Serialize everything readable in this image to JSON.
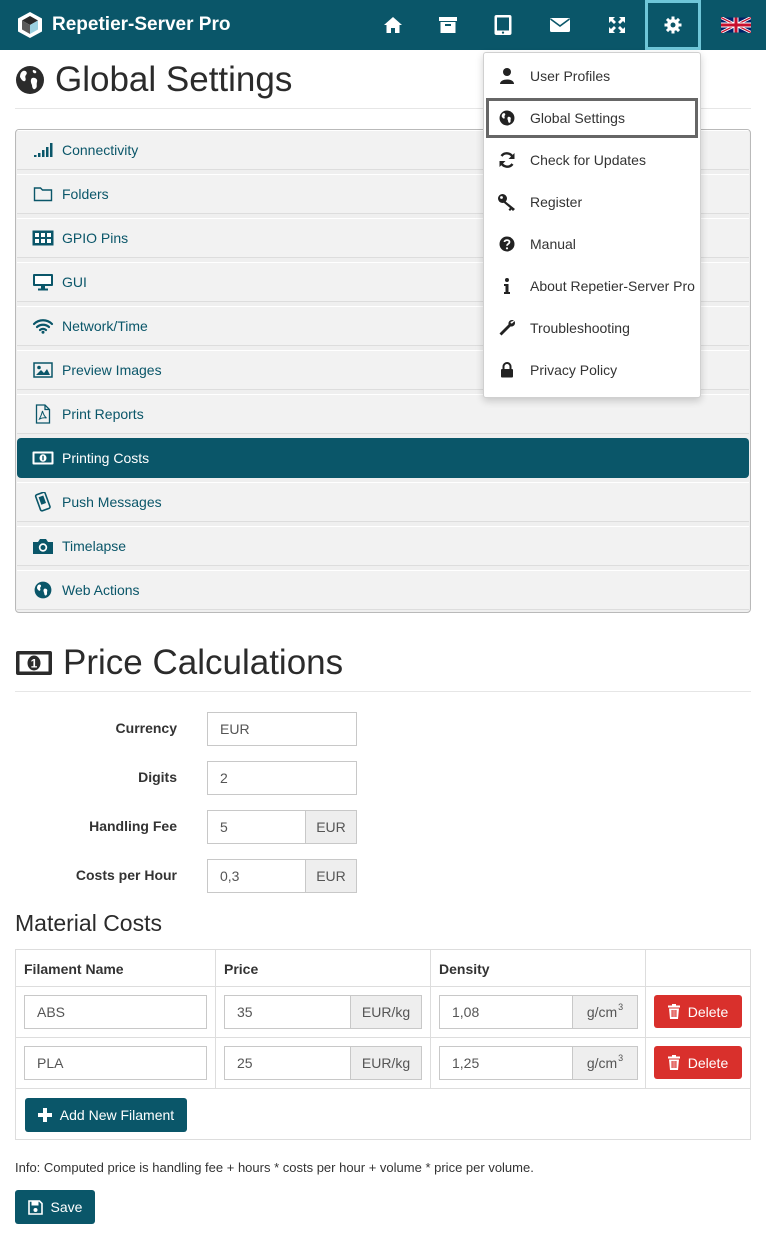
{
  "app": {
    "title": "Repetier-Server Pro"
  },
  "navbar": {
    "buttons": [
      "home-icon",
      "archive-icon",
      "tablet-icon",
      "envelope-icon",
      "fullscreen-icon",
      "gear-icon",
      "uk-flag-icon"
    ],
    "accent": "#0a5669"
  },
  "dropdown": {
    "items": [
      {
        "label": "User Profiles",
        "icon": "user-icon"
      },
      {
        "label": "Global Settings",
        "icon": "globe-icon",
        "selected": true
      },
      {
        "label": "Check for Updates",
        "icon": "refresh-icon"
      },
      {
        "label": "Register",
        "icon": "key-icon"
      },
      {
        "label": "Manual",
        "icon": "question-icon"
      },
      {
        "label": "About Repetier-Server Pro",
        "icon": "info-icon"
      },
      {
        "label": "Troubleshooting",
        "icon": "wrench-icon"
      },
      {
        "label": "Privacy Policy",
        "icon": "lock-icon"
      }
    ]
  },
  "page": {
    "title": "Global Settings"
  },
  "settings": {
    "items": [
      {
        "label": "Connectivity",
        "icon": "signal-icon"
      },
      {
        "label": "Folders",
        "icon": "folder-icon"
      },
      {
        "label": "GPIO Pins",
        "icon": "grid-icon"
      },
      {
        "label": "GUI",
        "icon": "monitor-icon"
      },
      {
        "label": "Network/Time",
        "icon": "wifi-icon"
      },
      {
        "label": "Preview Images",
        "icon": "image-icon"
      },
      {
        "label": "Print Reports",
        "icon": "pdf-icon"
      },
      {
        "label": "Printing Costs",
        "icon": "money-icon",
        "active": true
      },
      {
        "label": "Push Messages",
        "icon": "phone-icon"
      },
      {
        "label": "Timelapse",
        "icon": "camera-icon"
      },
      {
        "label": "Web Actions",
        "icon": "globe-icon"
      }
    ]
  },
  "price": {
    "title": "Price Calculations",
    "currency_label": "Currency",
    "currency_value": "EUR",
    "digits_label": "Digits",
    "digits_value": "2",
    "handling_label": "Handling Fee",
    "handling_value": "5",
    "handling_unit": "EUR",
    "hour_label": "Costs per Hour",
    "hour_value": "0,3",
    "hour_unit": "EUR"
  },
  "materials": {
    "title": "Material Costs",
    "headers": [
      "Filament Name",
      "Price",
      "Density"
    ],
    "rows": [
      {
        "name": "ABS",
        "price": "35",
        "price_unit": "EUR/kg",
        "density": "1,08",
        "density_unit": "g/cm",
        "density_exp": "3",
        "delete": "Delete"
      },
      {
        "name": "PLA",
        "price": "25",
        "price_unit": "EUR/kg",
        "density": "1,25",
        "density_unit": "g/cm",
        "density_exp": "3",
        "delete": "Delete"
      }
    ],
    "add_label": "Add New Filament"
  },
  "info_text": "Info: Computed price is handling fee + hours * costs per hour + volume * price per volume.",
  "save_label": "Save",
  "colors": {
    "delete": "#d9302c",
    "primary": "#0a5669"
  }
}
